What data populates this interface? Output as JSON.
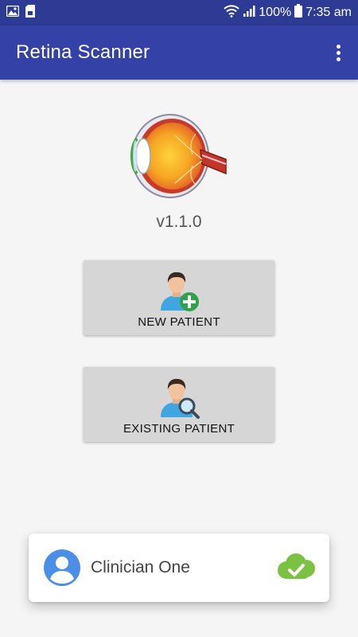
{
  "status_bar": {
    "battery_percent": "100%",
    "time": "7:35 am",
    "icons": [
      "image-icon",
      "sd-card-icon",
      "wifi-icon",
      "signal-icon",
      "battery-icon"
    ]
  },
  "app_bar": {
    "title": "Retina Scanner",
    "menu_icon": "overflow-menu-icon"
  },
  "main": {
    "logo_icon": "eye-anatomy-icon",
    "version": "v1.1.0",
    "buttons": [
      {
        "label": "NEW PATIENT",
        "icon": "add-patient-icon"
      },
      {
        "label": "EXISTING PATIENT",
        "icon": "search-patient-icon"
      }
    ]
  },
  "user_card": {
    "name": "Clinician One",
    "avatar_icon": "account-circle-icon",
    "sync_icon": "cloud-check-icon"
  },
  "colors": {
    "primary": "#3441a6",
    "primary_dark": "#2d3b94",
    "button_bg": "#d6d6d6",
    "avatar_blue": "#4a8ee8",
    "sync_green": "#7cc242"
  }
}
